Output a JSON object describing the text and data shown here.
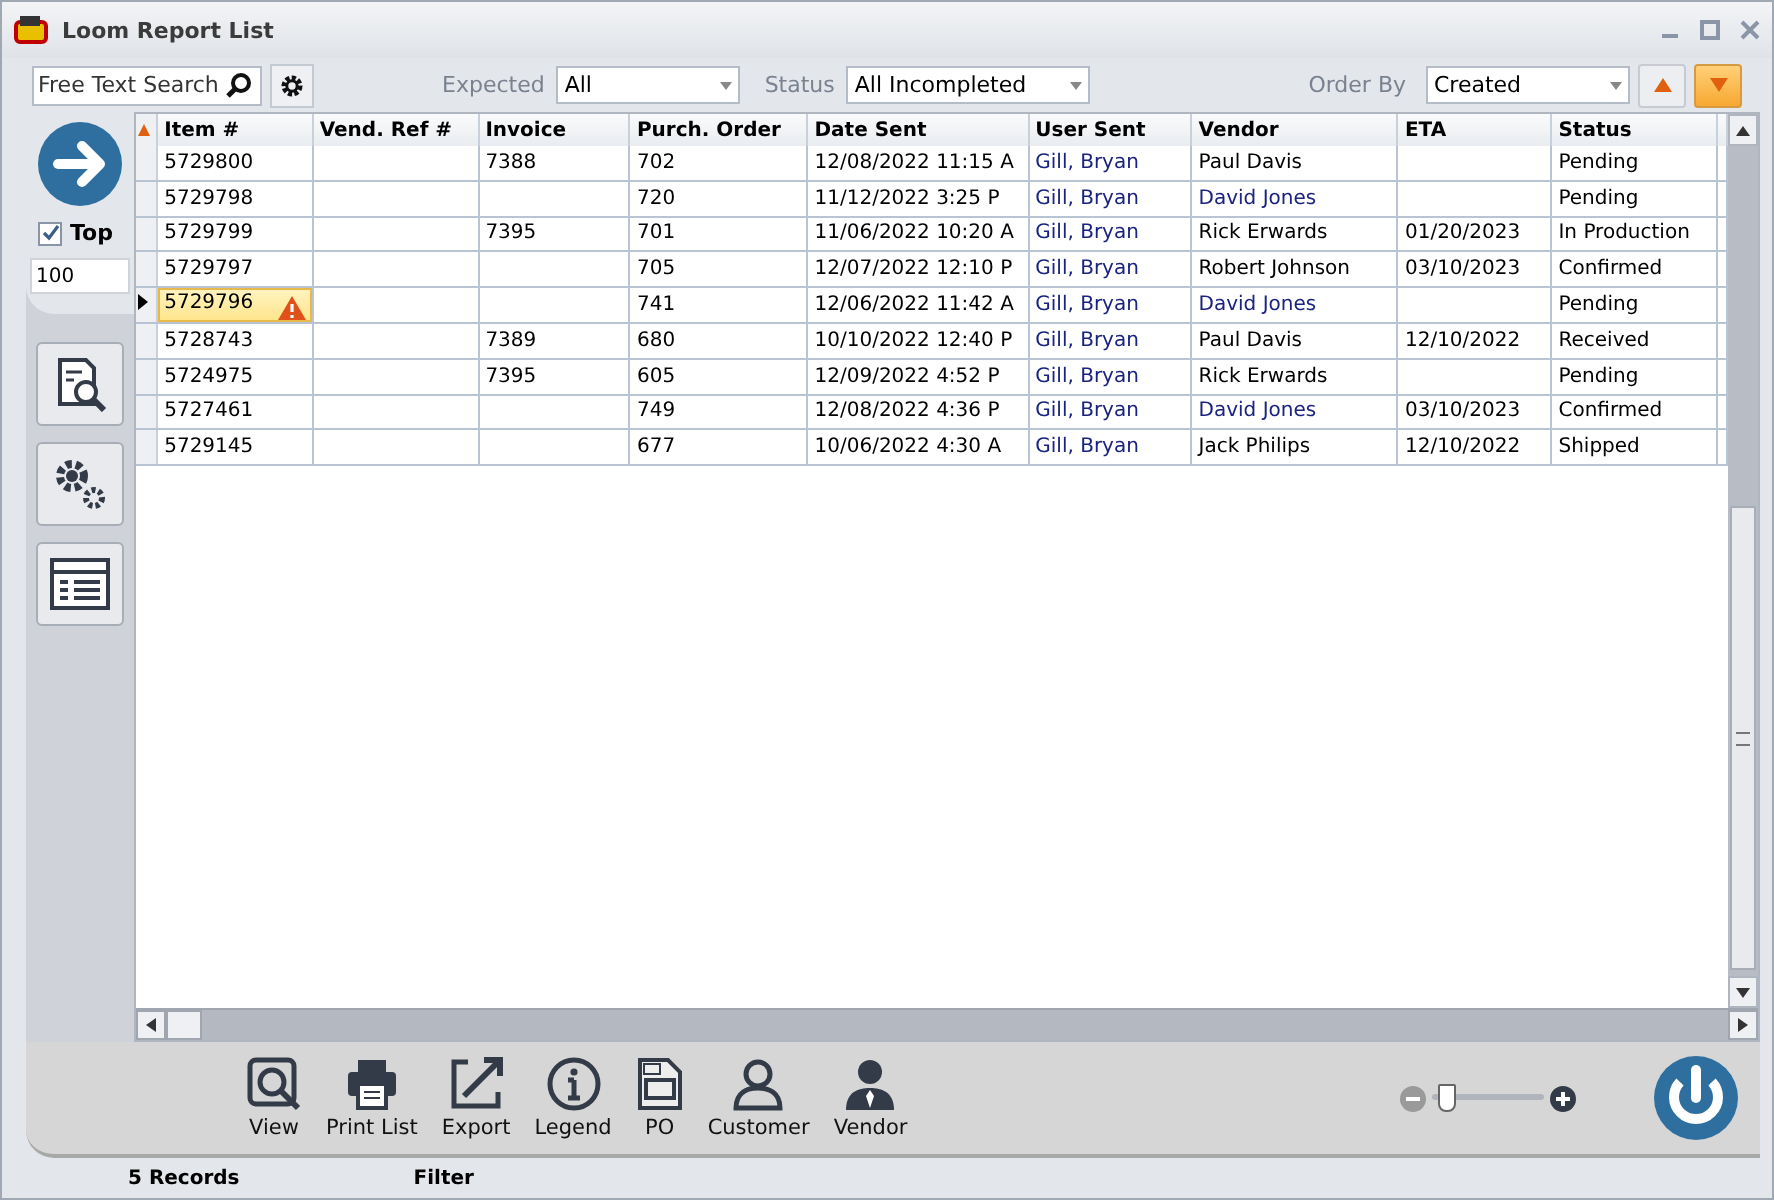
{
  "window": {
    "title": "Loom Report List"
  },
  "toolbar": {
    "search": {
      "placeholder": "Free Text Search"
    },
    "expected": {
      "label": "Expected",
      "value": "All"
    },
    "status": {
      "label": "Status",
      "value": "All Incompleted"
    },
    "order_by": {
      "label": "Order By",
      "value": "Created"
    },
    "sort": [
      {
        "kind": "ascending",
        "selected": false
      },
      {
        "kind": "descending",
        "selected": true
      }
    ]
  },
  "side": {
    "top": {
      "label": "Top",
      "checked": true,
      "value": "100"
    }
  },
  "table": {
    "columns": [
      "Item #",
      "Vend. Ref #",
      "Invoice",
      "Purch. Order",
      "Date Sent",
      "User Sent",
      "Vendor",
      "ETA",
      "Status"
    ],
    "rows": [
      {
        "item": "5729800",
        "vend_ref": "",
        "invoice": "7388",
        "po": "702",
        "date_sent": "12/08/2022 11:15 A",
        "user_sent": "Gill, Bryan",
        "vendor": "Paul Davis",
        "vendor_link": false,
        "eta": "",
        "status": "Pending",
        "selected": false,
        "warning": false
      },
      {
        "item": "5729798",
        "vend_ref": "",
        "invoice": "",
        "po": "720",
        "date_sent": "11/12/2022 3:25 P",
        "user_sent": "Gill, Bryan",
        "vendor": "David Jones",
        "vendor_link": true,
        "eta": "",
        "status": "Pending",
        "selected": false,
        "warning": false
      },
      {
        "item": "5729799",
        "vend_ref": "",
        "invoice": "7395",
        "po": "701",
        "date_sent": "11/06/2022 10:20 A",
        "user_sent": "Gill, Bryan",
        "vendor": "Rick Erwards",
        "vendor_link": false,
        "eta": "01/20/2023",
        "status": "In Production",
        "selected": false,
        "warning": false
      },
      {
        "item": "5729797",
        "vend_ref": "",
        "invoice": "",
        "po": "705",
        "date_sent": "12/07/2022 12:10 P",
        "user_sent": "Gill, Bryan",
        "vendor": "Robert Johnson",
        "vendor_link": false,
        "eta": "03/10/2023",
        "status": "Confirmed",
        "selected": false,
        "warning": false
      },
      {
        "item": "5729796",
        "vend_ref": "",
        "invoice": "",
        "po": "741",
        "date_sent": "12/06/2022 11:42 A",
        "user_sent": "Gill, Bryan",
        "vendor": "David Jones",
        "vendor_link": true,
        "eta": "",
        "status": "Pending",
        "selected": true,
        "warning": true
      },
      {
        "item": "5728743",
        "vend_ref": "",
        "invoice": "7389",
        "po": "680",
        "date_sent": "10/10/2022 12:40 P",
        "user_sent": "Gill, Bryan",
        "vendor": "Paul Davis",
        "vendor_link": false,
        "eta": "12/10/2022",
        "status": "Received",
        "selected": false,
        "warning": false
      },
      {
        "item": "5724975",
        "vend_ref": "",
        "invoice": "7395",
        "po": "605",
        "date_sent": "12/09/2022 4:52 P",
        "user_sent": "Gill, Bryan",
        "vendor": "Rick Erwards",
        "vendor_link": false,
        "eta": "",
        "status": "Pending",
        "selected": false,
        "warning": false
      },
      {
        "item": "5727461",
        "vend_ref": "",
        "invoice": "",
        "po": "749",
        "date_sent": "12/08/2022 4:36 P",
        "user_sent": "Gill, Bryan",
        "vendor": "David Jones",
        "vendor_link": true,
        "eta": "03/10/2023",
        "status": "Confirmed",
        "selected": false,
        "warning": false
      },
      {
        "item": "5729145",
        "vend_ref": "",
        "invoice": "",
        "po": "677",
        "date_sent": "10/06/2022 4:30 A",
        "user_sent": "Gill, Bryan",
        "vendor": "Jack Philips",
        "vendor_link": false,
        "eta": "12/10/2022",
        "status": "Shipped",
        "selected": false,
        "warning": false
      }
    ]
  },
  "actions": [
    {
      "kind": "view",
      "label": "View"
    },
    {
      "kind": "print",
      "label": "Print List"
    },
    {
      "kind": "export",
      "label": "Export"
    },
    {
      "kind": "legend",
      "label": "Legend"
    },
    {
      "kind": "po",
      "label": "PO"
    },
    {
      "kind": "customer",
      "label": "Customer"
    },
    {
      "kind": "vendor",
      "label": "Vendor"
    }
  ],
  "zoom": {
    "level": 0.05
  },
  "status_bar": {
    "records": "5 Records",
    "filter": "Filter"
  }
}
